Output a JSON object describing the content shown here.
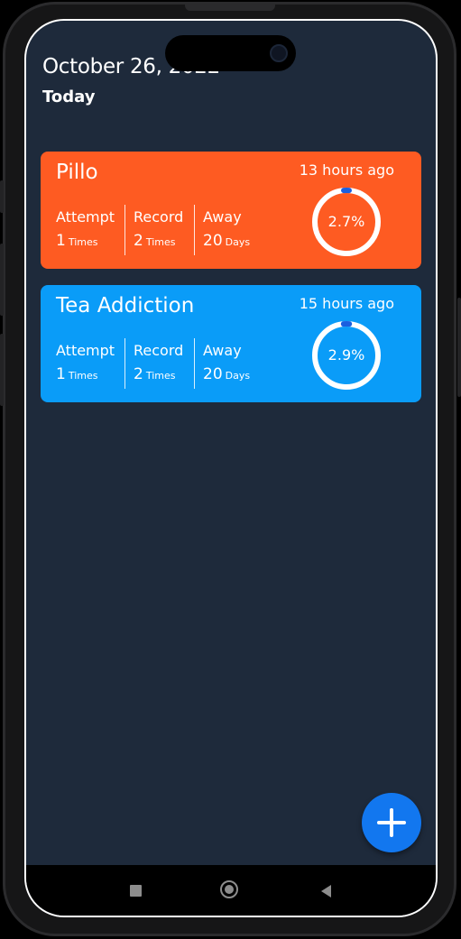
{
  "header": {
    "date": "October 26, 2022",
    "subtitle": "Today"
  },
  "habits": [
    {
      "name": "Pillo",
      "time_ago": "13 hours ago",
      "color": "#fe5b22",
      "stats": [
        {
          "label": "Attempt",
          "value": "1",
          "unit": "Times"
        },
        {
          "label": "Record",
          "value": "2",
          "unit": "Times"
        },
        {
          "label": "Away",
          "value": "20",
          "unit": "Days"
        }
      ],
      "progress_label": "2.7%",
      "progress": 0.027
    },
    {
      "name": "Tea Addiction",
      "time_ago": "15 hours ago",
      "color": "#0a9cf8",
      "stats": [
        {
          "label": "Attempt",
          "value": "1",
          "unit": "Times"
        },
        {
          "label": "Record",
          "value": "2",
          "unit": "Times"
        },
        {
          "label": "Away",
          "value": "20",
          "unit": "Days"
        }
      ],
      "progress_label": "2.9%",
      "progress": 0.029
    }
  ],
  "fab": {
    "icon": "plus-icon",
    "color": "#1277ef"
  },
  "navbar": {
    "recents_icon": "square-icon",
    "home_icon": "circle-icon",
    "back_icon": "triangle-back-icon"
  },
  "colors": {
    "screen_background": "#1e2a3b",
    "ring_progress": "#1a5fe0"
  }
}
